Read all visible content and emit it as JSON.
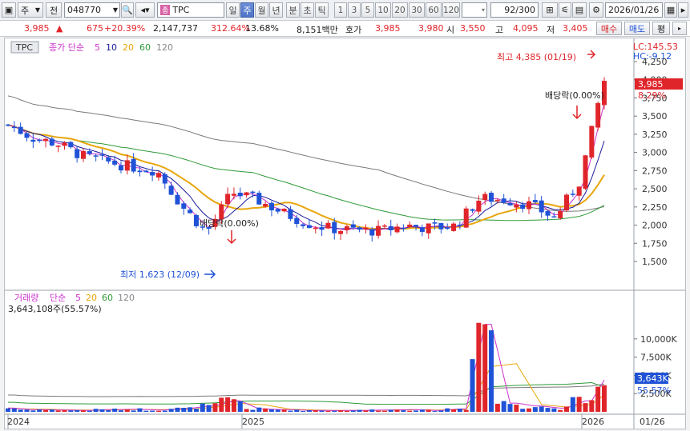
{
  "toolbar": {
    "market_label": "주",
    "market_btn": "전",
    "code": "048770",
    "name": "TPC",
    "periods": [
      "일",
      "주",
      "월",
      "년",
      "분",
      "초",
      "틱"
    ],
    "active_period": "주",
    "numbers": [
      "1",
      "3",
      "5",
      "10",
      "20",
      "30",
      "60",
      "120"
    ],
    "count": "92/300",
    "date": "2026/01/26"
  },
  "quote": {
    "price": "3,985",
    "change": "675",
    "change_pct": "+20.39%",
    "volume": "2,147,737",
    "volume_ratio": "312.64%",
    "turnover": "13.68%",
    "amount": "8,151백만",
    "ask_label": "호가",
    "ask": "3,985",
    "bid": "3,980",
    "open_label": "시",
    "open": "3,550",
    "high_label": "고",
    "high": "4,095",
    "low_label": "저",
    "low": "3,405",
    "buy_btn": "매수",
    "sell_btn": "매도",
    "eval_btn": "평"
  },
  "price_panel": {
    "tag": "TPC",
    "legend": [
      "종가 단순",
      "5",
      "10",
      "20",
      "60",
      "120"
    ],
    "lc": "LC:145.53",
    "hc": "HC:-9.12",
    "current_price": "3,985",
    "current_pct": "8.29%",
    "high_note": "최고 4,385 (01/19)",
    "low_note": "최저 1,623 (12/09)",
    "dividend_note": "배당락(0.00%)",
    "y_ticks": [
      "4,250",
      "4,000",
      "3,750",
      "3,500",
      "3,250",
      "3,000",
      "2,750",
      "2,500",
      "2,250",
      "2,000",
      "1,750",
      "1,500"
    ]
  },
  "volume_panel": {
    "legend": [
      "거래량",
      "단순",
      "5",
      "20",
      "60",
      "120"
    ],
    "current": "3,643,108주(55.57%)",
    "current_tag": "3,643K",
    "current_pct": "55.57%",
    "y_ticks": [
      "10,000K",
      "7,500K",
      "5,000K",
      "2,500K"
    ]
  },
  "x_axis": {
    "labels": [
      "2024",
      "2025",
      "2026"
    ],
    "last_date": "01/26"
  },
  "colors": {
    "up": "#e0252a",
    "down": "#1f52d6",
    "ma5": "#cc33cc",
    "ma10": "#1a1a9a",
    "ma20": "#e8a60c",
    "ma60": "#2e9a38",
    "ma120": "#7a7a7a"
  },
  "chart_data": {
    "type": "candlestick",
    "x": [
      "2024-01",
      "2024-02",
      "2024-03",
      "2024-04",
      "2024-05",
      "2024-06",
      "2024-07",
      "2024-08",
      "2024-09",
      "2024-10",
      "2024-11",
      "2024-12",
      "2025-01",
      "2025-02",
      "2025-03",
      "2025-04",
      "2025-05",
      "2025-06",
      "2025-07",
      "2025-08",
      "2025-09",
      "2025-10",
      "2025-11",
      "2025-12",
      "2026-01"
    ],
    "close": [
      3380,
      3200,
      3120,
      2950,
      2870,
      2800,
      2750,
      2260,
      1900,
      2450,
      2350,
      2180,
      2030,
      1950,
      1930,
      1920,
      2000,
      1960,
      1990,
      2370,
      2350,
      2280,
      2100,
      2600,
      3985
    ],
    "volume_k": [
      500,
      300,
      250,
      200,
      300,
      350,
      250,
      450,
      800,
      1500,
      400,
      300,
      200,
      180,
      200,
      250,
      300,
      200,
      400,
      12000,
      1200,
      800,
      500,
      1500,
      5800
    ],
    "ylim": [
      1500,
      4385
    ]
  }
}
